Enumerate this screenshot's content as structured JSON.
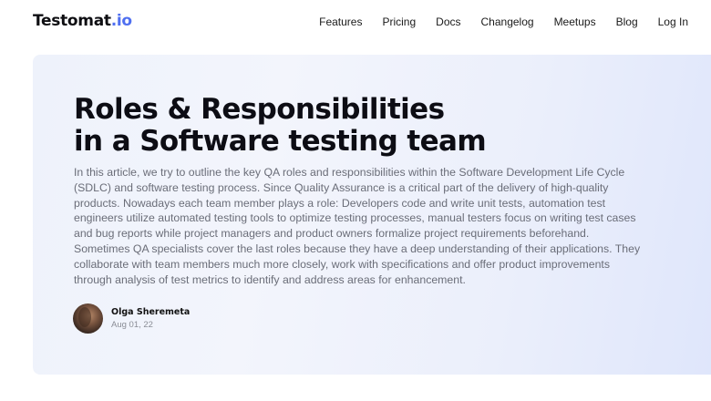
{
  "header": {
    "logo": {
      "text": "Testomat",
      "tld": ".io"
    },
    "nav": [
      {
        "label": "Features"
      },
      {
        "label": "Pricing"
      },
      {
        "label": "Docs"
      },
      {
        "label": "Changelog"
      },
      {
        "label": "Meetups"
      },
      {
        "label": "Blog"
      },
      {
        "label": "Log In"
      }
    ]
  },
  "hero": {
    "title_line1": "Roles & Responsibilities",
    "title_line2": "in a Software testing team",
    "description": "In this article, we try to outline the key QA roles and responsibilities within the Software Development Life Cycle (SDLC) and software testing process. Since Quality Assurance is a critical part of the delivery of high-quality products. Nowadays each team member plays a role: Developers code and write unit tests, automation test engineers utilize automated testing tools to optimize testing processes, manual testers focus on writing test cases and bug reports while project managers and product owners formalize project requirements beforehand. Sometimes QA specialists cover the last roles because they have a deep understanding of their applications. They collaborate with team members much more closely, work with specifications and offer product improvements through analysis of test metrics to identify and address areas for enhancement.",
    "author": {
      "name": "Olga Sheremeta",
      "date": "Aug 01, 22"
    }
  },
  "colors": {
    "brand_accent": "#4f6ff0",
    "title_text": "#0d0d14",
    "body_text": "#6a6d78",
    "hero_bg_start": "#eef2fb",
    "hero_bg_end": "#dfe6fb"
  }
}
